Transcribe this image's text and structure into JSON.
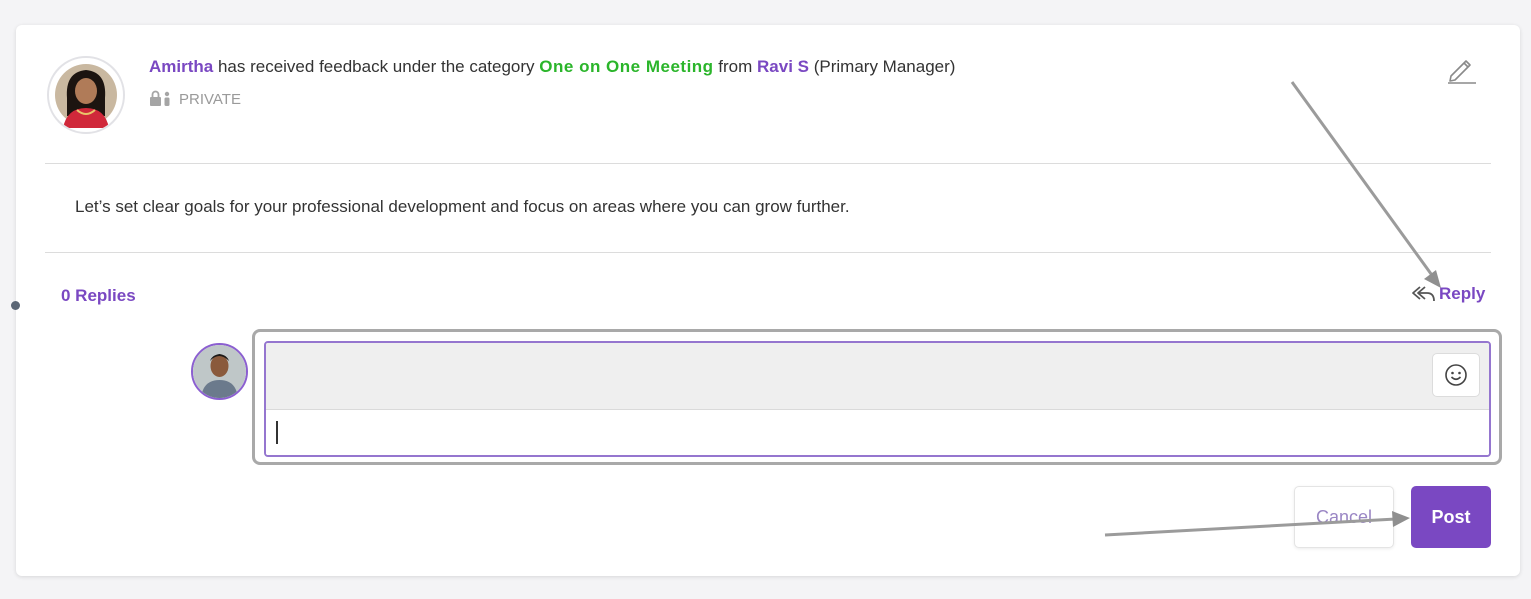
{
  "feedback": {
    "recipient_name": "Amirtha",
    "phrase_received": " has received feedback under the category ",
    "category": "One on One Meeting",
    "phrase_from": " from ",
    "giver_name": "Ravi S",
    "giver_role": " (Primary Manager)",
    "visibility": "PRIVATE",
    "message": "Let’s set clear goals for your professional development and focus on areas where you can grow further."
  },
  "replies": {
    "count_label": "0 Replies",
    "reply_label": "Reply"
  },
  "reply_box": {
    "input_value": "",
    "cancel_label": "Cancel",
    "post_label": "Post"
  },
  "icons": {
    "edit": "pencil-icon",
    "lock": "lock-users-icon",
    "reply": "reply-arrow-icon",
    "emoji": "smiley-icon"
  },
  "colors": {
    "accent": "#7a48c2",
    "category": "#2bb52b"
  }
}
